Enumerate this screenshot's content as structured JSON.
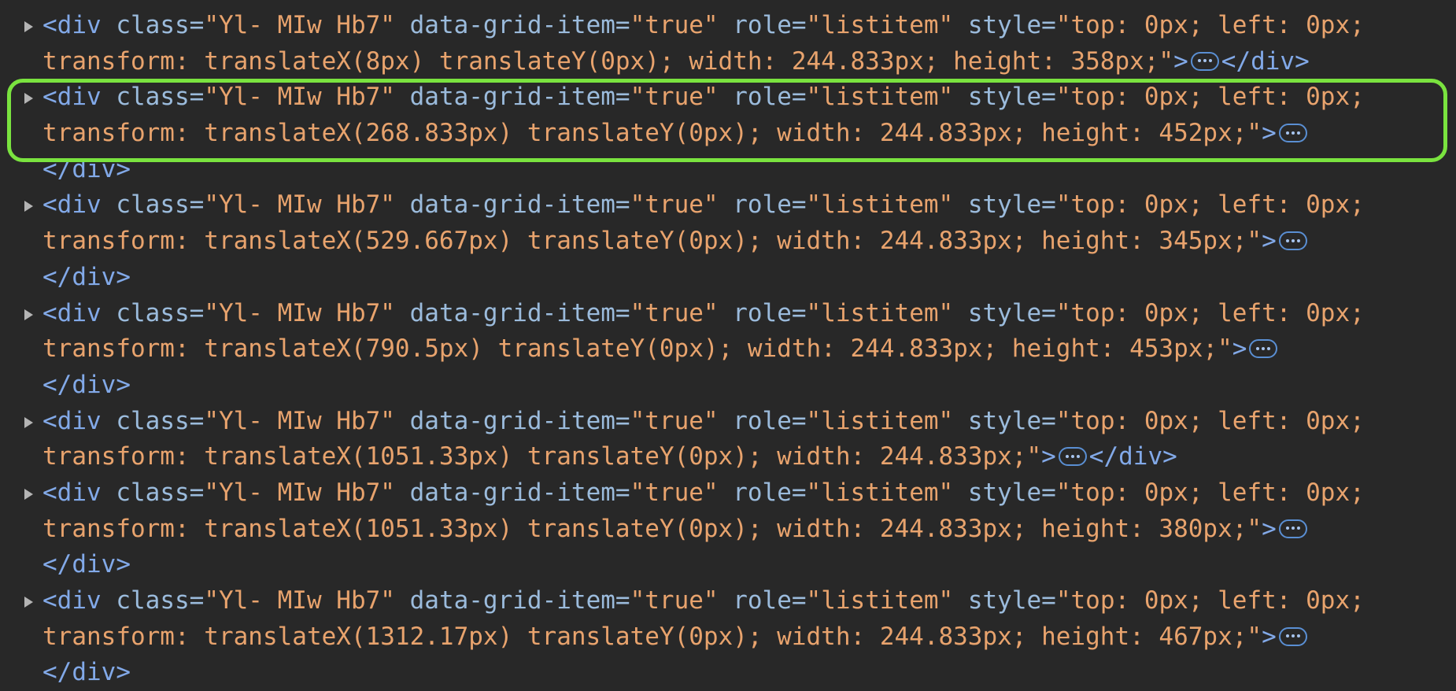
{
  "nodes": [
    {
      "tag": "div",
      "class_attr": "Yl- MIw Hb7",
      "grid_item": "true",
      "role": "listitem",
      "style_line1": "top: 0px; left: 0px;",
      "style_line2": "transform: translateX(8px) translateY(0px); width: 244.833px; height: 358px;",
      "closing_inline": true
    },
    {
      "tag": "div",
      "class_attr": "Yl- MIw Hb7",
      "grid_item": "true",
      "role": "listitem",
      "style_line1": "top: 0px; left: 0px;",
      "style_line2": "transform: translateX(268.833px) translateY(0px); width: 244.833px; height: 452px;",
      "closing_inline": false,
      "highlighted": true
    },
    {
      "tag": "div",
      "class_attr": "Yl- MIw Hb7",
      "grid_item": "true",
      "role": "listitem",
      "style_line1": "top: 0px; left: 0px;",
      "style_line2": "transform: translateX(529.667px) translateY(0px); width: 244.833px; height: 345px;",
      "closing_inline": false
    },
    {
      "tag": "div",
      "class_attr": "Yl- MIw Hb7",
      "grid_item": "true",
      "role": "listitem",
      "style_line1": "top: 0px; left: 0px;",
      "style_line2": "transform: translateX(790.5px) translateY(0px); width: 244.833px; height: 453px;",
      "closing_inline": false
    },
    {
      "tag": "div",
      "class_attr": "Yl- MIw Hb7",
      "grid_item": "true",
      "role": "listitem",
      "style_line1": "top: 0px; left: 0px;",
      "style_line2": "transform: translateX(1051.33px) translateY(0px); width: 244.833px;",
      "closing_inline": true
    },
    {
      "tag": "div",
      "class_attr": "Yl- MIw Hb7",
      "grid_item": "true",
      "role": "listitem",
      "style_line1": "top: 0px; left: 0px;",
      "style_line2": "transform: translateX(1051.33px) translateY(0px); width: 244.833px; height: 380px;",
      "closing_inline": false
    },
    {
      "tag": "div",
      "class_attr": "Yl- MIw Hb7",
      "grid_item": "true",
      "role": "listitem",
      "style_line1": "top: 0px; left: 0px;",
      "style_line2": "transform: translateX(1312.17px) translateY(0px); width: 244.833px; height: 467px;",
      "closing_inline": false
    }
  ],
  "attr_labels": {
    "class": "class",
    "grid": "data-grid-item",
    "role": "role",
    "style": "style"
  },
  "colors": {
    "background": "#282828",
    "tag": "#82a9e8",
    "attr_name": "#9bbbdc",
    "attr_value": "#e8a36d",
    "highlight": "#7ae33f"
  },
  "icons": {
    "expand": "disclosure-triangle-icon",
    "collapsed_children": "ellipsis-icon"
  }
}
